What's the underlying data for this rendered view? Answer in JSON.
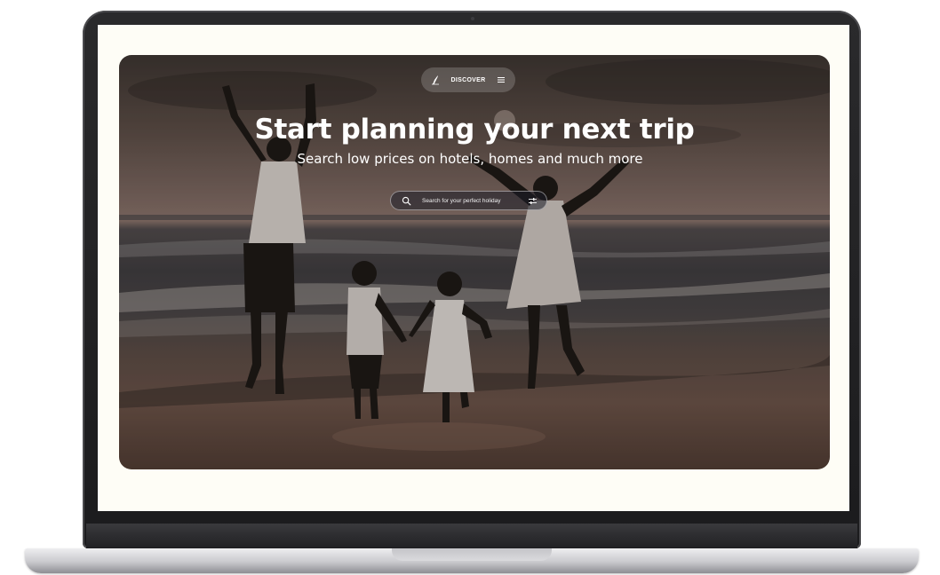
{
  "nav": {
    "logo_icon": "paragliding-logo-icon",
    "label": "DISCOVER",
    "menu_icon": "hamburger-menu-icon"
  },
  "hero": {
    "title": "Start planning your next trip",
    "subtitle": "Search low prices on hotels, homes and much more"
  },
  "search": {
    "icon": "search-icon",
    "placeholder": "Search for your perfect holiday",
    "filter_icon": "filter-sliders-icon"
  },
  "colors": {
    "page_background": "#fefdf6",
    "text_on_image": "#ffffff"
  }
}
